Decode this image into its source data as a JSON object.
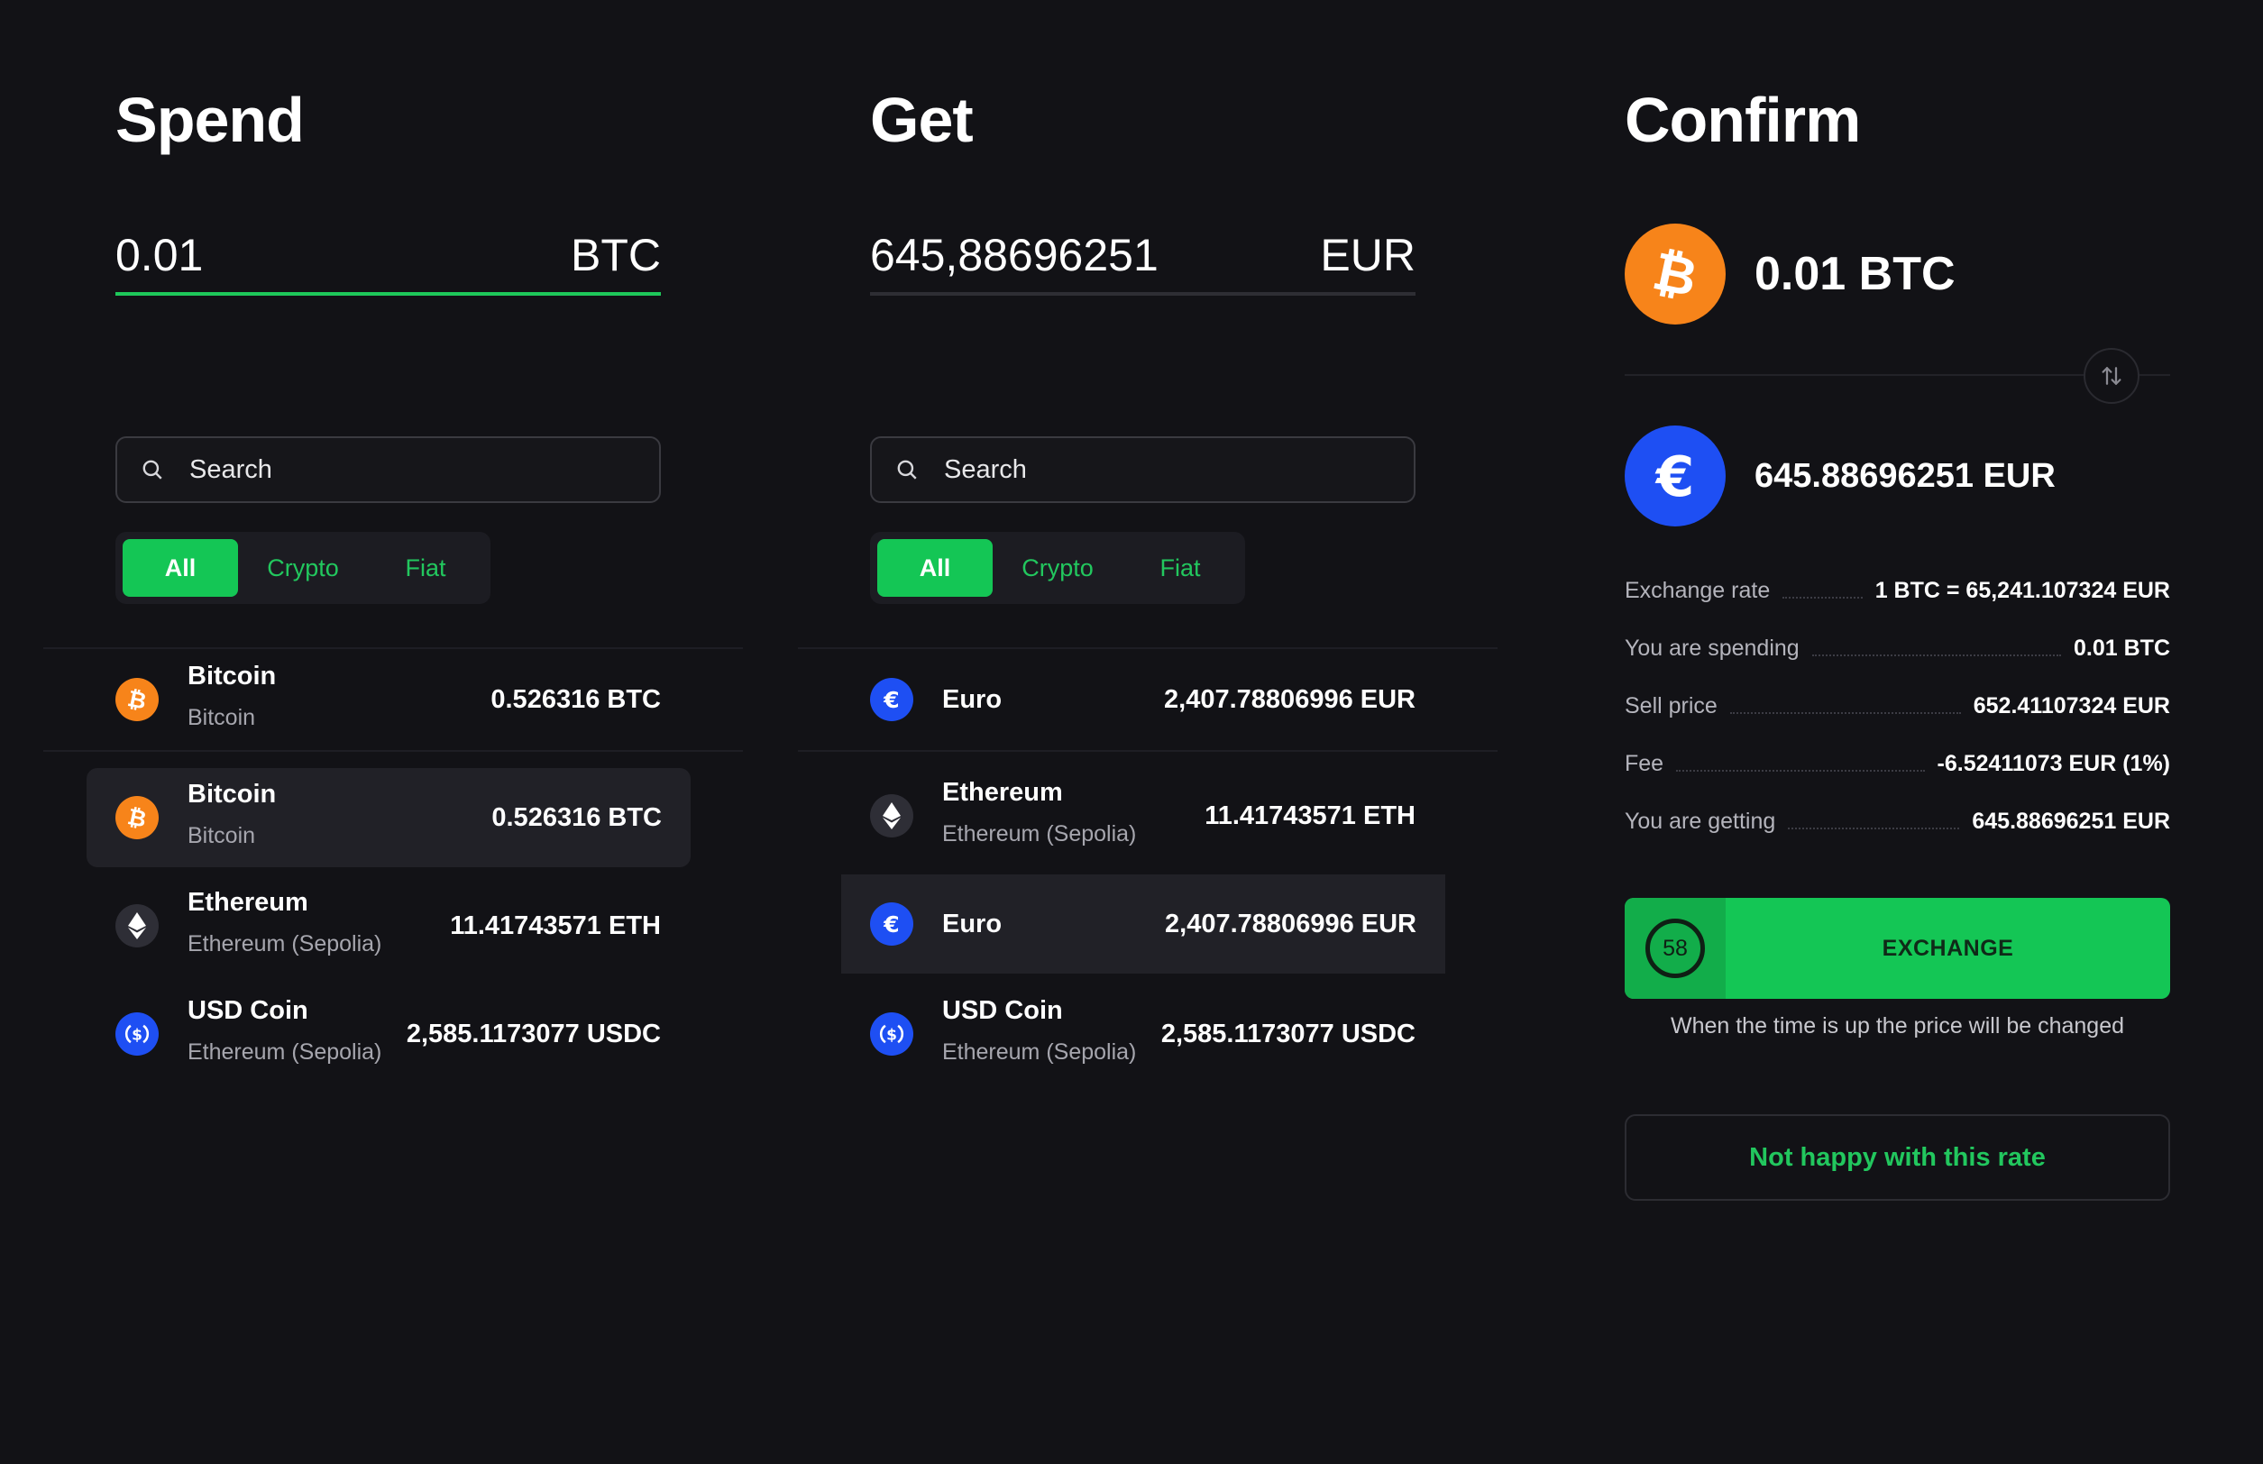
{
  "spend": {
    "title": "Spend",
    "amount": "0.01",
    "unit": "BTC",
    "search_placeholder": "Search",
    "filters": [
      "All",
      "Crypto",
      "Fiat"
    ],
    "assets": [
      {
        "name": "Bitcoin",
        "network": "Bitcoin",
        "balance": "0.526316 BTC",
        "icon": "bitcoin-icon"
      },
      {
        "name": "Bitcoin",
        "network": "Bitcoin",
        "balance": "0.526316 BTC",
        "icon": "bitcoin-icon"
      },
      {
        "name": "Ethereum",
        "network": "Ethereum (Sepolia)",
        "balance": "11.41743571 ETH",
        "icon": "ethereum-icon"
      },
      {
        "name": "USD Coin",
        "network": "Ethereum (Sepolia)",
        "balance": "2,585.1173077 USDC",
        "icon": "usdc-icon"
      }
    ]
  },
  "get": {
    "title": "Get",
    "amount": "645,88696251",
    "unit": "EUR",
    "search_placeholder": "Search",
    "filters": [
      "All",
      "Crypto",
      "Fiat"
    ],
    "assets": [
      {
        "name": "Euro",
        "balance": "2,407.78806996 EUR",
        "icon": "euro-icon"
      },
      {
        "name": "Ethereum",
        "network": "Ethereum (Sepolia)",
        "balance": "11.41743571 ETH",
        "icon": "ethereum-icon"
      },
      {
        "name": "Euro",
        "balance": "2,407.78806996 EUR",
        "icon": "euro-icon"
      },
      {
        "name": "USD Coin",
        "network": "Ethereum (Sepolia)",
        "balance": "2,585.1173077 USDC",
        "icon": "usdc-icon"
      }
    ]
  },
  "confirm": {
    "title": "Confirm",
    "spend_value": "0.01 BTC",
    "get_value": "645.88696251 EUR",
    "rows": [
      {
        "label": "Exchange rate",
        "value": "1 BTC = 65,241.107324 EUR"
      },
      {
        "label": "You are spending",
        "value": "0.01 BTC"
      },
      {
        "label": "Sell price",
        "value": "652.41107324 EUR"
      },
      {
        "label": "Fee",
        "value": "-6.52411073 EUR (1%)"
      },
      {
        "label": "You are getting",
        "value": "645.88696251 EUR"
      }
    ],
    "timer": "58",
    "exchange_label": "EXCHANGE",
    "timer_note": "When the time is up the price will be changed",
    "unhappy_label": "Not happy with this rate"
  },
  "colors": {
    "background": "#121216",
    "accent": "#14c655",
    "bitcoin": "#f7841a",
    "euro": "#1e4ff3"
  }
}
